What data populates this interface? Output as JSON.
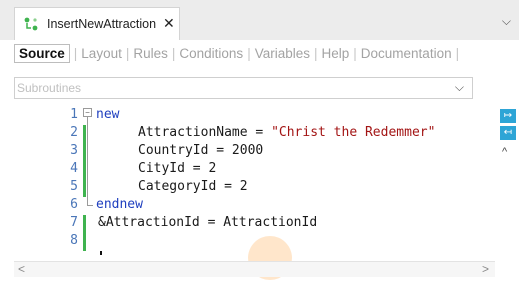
{
  "document_tab": {
    "title": "InsertNewAttraction",
    "close": "✕",
    "icon": "procedure-icon"
  },
  "window": {
    "overflow_chevron": "⌵"
  },
  "section_tabs": [
    {
      "label": "Source",
      "active": true
    },
    {
      "label": "Layout",
      "active": false
    },
    {
      "label": "Rules",
      "active": false
    },
    {
      "label": "Conditions",
      "active": false
    },
    {
      "label": "Variables",
      "active": false
    },
    {
      "label": "Help",
      "active": false
    },
    {
      "label": "Documentation",
      "active": false
    }
  ],
  "subroutines": {
    "placeholder": "Subroutines",
    "chevron": "⌵"
  },
  "editor": {
    "line_numbers": [
      "1",
      "2",
      "3",
      "4",
      "5",
      "6",
      "7",
      "8"
    ],
    "lines": {
      "l1": "new",
      "l2_name": "AttractionName = ",
      "l2_str": "\"Christ the Redemmer\"",
      "l3": "CountryId = 2000",
      "l4": "CityId = 2",
      "l5": "CategoryId = 2",
      "l6": "endnew",
      "l7_var": "&AttractionId",
      "l7_rest": " = AttractionId"
    },
    "fold_sign": "−",
    "colors": {
      "keyword": "#1f3fbf",
      "string": "#a31515",
      "change_bar": "#3fb34f",
      "line_number": "#4a76b8"
    }
  },
  "right_toolbar": {
    "btn1": "↦",
    "btn2": "↤",
    "caret": "^"
  },
  "scrollbar": {
    "left": "<",
    "right": ">"
  }
}
